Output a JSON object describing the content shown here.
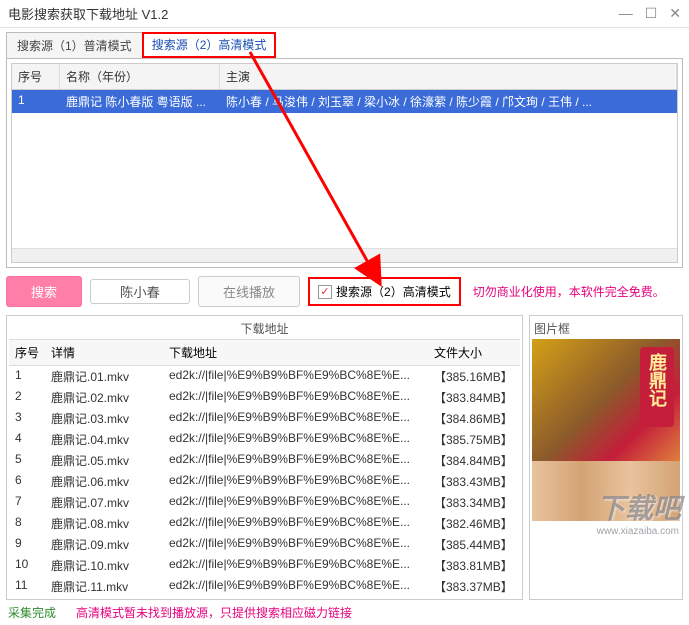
{
  "window": {
    "title": "电影搜索获取下载地址 V1.2"
  },
  "tabs": {
    "tab1": "搜索源（1）普清模式",
    "tab2": "搜索源（2）高清模式"
  },
  "grid1": {
    "headers": {
      "seq": "序号",
      "name": "名称（年份）",
      "cast": "主演"
    },
    "row": {
      "seq": "1",
      "name": "鹿鼎记 陈小春版 粤语版 ...",
      "cast": "陈小春 / 马浚伟 / 刘玉翠 / 梁小冰 / 徐濠萦 / 陈少霞 / 邝文珣 / 王伟 / ..."
    }
  },
  "toolbar": {
    "search_btn": "搜索",
    "search_value": "陈小春",
    "play_btn": "在线播放",
    "chk_label": "搜索源（2）高清模式",
    "note": "切勿商业化使用，本软件完全免费。"
  },
  "dl": {
    "title": "下载地址",
    "headers": {
      "seq": "序号",
      "detail": "详情",
      "url": "下载地址",
      "size": "文件大小"
    },
    "rows": [
      {
        "seq": "1",
        "detail": "鹿鼎记.01.mkv",
        "url": "ed2k://|file|%E9%B9%BF%E9%BC%8E%E...",
        "size": "【385.16MB】"
      },
      {
        "seq": "2",
        "detail": "鹿鼎记.02.mkv",
        "url": "ed2k://|file|%E9%B9%BF%E9%BC%8E%E...",
        "size": "【383.84MB】"
      },
      {
        "seq": "3",
        "detail": "鹿鼎记.03.mkv",
        "url": "ed2k://|file|%E9%B9%BF%E9%BC%8E%E...",
        "size": "【384.86MB】"
      },
      {
        "seq": "4",
        "detail": "鹿鼎记.04.mkv",
        "url": "ed2k://|file|%E9%B9%BF%E9%BC%8E%E...",
        "size": "【385.75MB】"
      },
      {
        "seq": "5",
        "detail": "鹿鼎记.05.mkv",
        "url": "ed2k://|file|%E9%B9%BF%E9%BC%8E%E...",
        "size": "【384.84MB】"
      },
      {
        "seq": "6",
        "detail": "鹿鼎记.06.mkv",
        "url": "ed2k://|file|%E9%B9%BF%E9%BC%8E%E...",
        "size": "【383.43MB】"
      },
      {
        "seq": "7",
        "detail": "鹿鼎记.07.mkv",
        "url": "ed2k://|file|%E9%B9%BF%E9%BC%8E%E...",
        "size": "【383.34MB】"
      },
      {
        "seq": "8",
        "detail": "鹿鼎记.08.mkv",
        "url": "ed2k://|file|%E9%B9%BF%E9%BC%8E%E...",
        "size": "【382.46MB】"
      },
      {
        "seq": "9",
        "detail": "鹿鼎记.09.mkv",
        "url": "ed2k://|file|%E9%B9%BF%E9%BC%8E%E...",
        "size": "【385.44MB】"
      },
      {
        "seq": "10",
        "detail": "鹿鼎记.10.mkv",
        "url": "ed2k://|file|%E9%B9%BF%E9%BC%8E%E...",
        "size": "【383.81MB】"
      },
      {
        "seq": "11",
        "detail": "鹿鼎记.11.mkv",
        "url": "ed2k://|file|%E9%B9%BF%E9%BC%8E%E...",
        "size": "【383.37MB】"
      }
    ]
  },
  "pic": {
    "title": "图片框"
  },
  "footer": {
    "status": "采集完成",
    "note": "高清模式暂未找到播放源，只提供搜索相应磁力链接"
  },
  "watermark": {
    "big": "下载吧",
    "small": "www.xiazaiba.com"
  }
}
